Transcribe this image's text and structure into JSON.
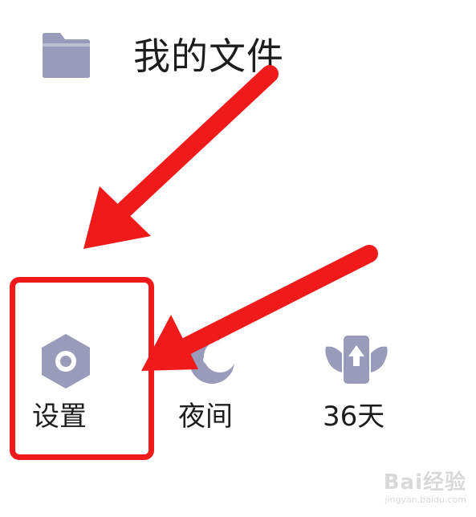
{
  "files": {
    "label": "我的文件",
    "icon": "folder-icon"
  },
  "shortcuts": [
    {
      "label": "设置",
      "icon": "gear-icon"
    },
    {
      "label": "夜间",
      "icon": "moon-icon"
    },
    {
      "label": "36天",
      "icon": "badge-wings-icon"
    }
  ],
  "watermark": {
    "brand": "Bai经验",
    "site": "jingyan.baidu.com"
  },
  "colors": {
    "icon": "#9a9bbb",
    "annotation": "#f11a1a",
    "text": "#1d1d1d"
  }
}
